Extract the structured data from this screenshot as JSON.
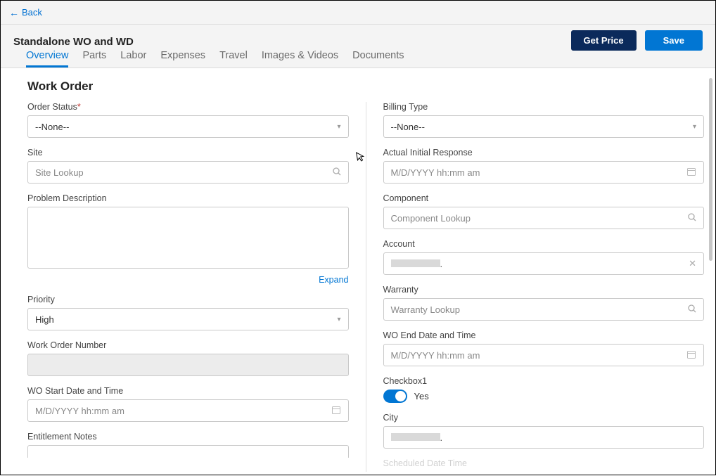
{
  "nav": {
    "back": "Back"
  },
  "header": {
    "title": "Standalone WO and WD",
    "getPrice": "Get Price",
    "save": "Save",
    "tabs": [
      "Overview",
      "Parts",
      "Labor",
      "Expenses",
      "Travel",
      "Images & Videos",
      "Documents"
    ]
  },
  "section": {
    "title": "Work Order"
  },
  "left": {
    "orderStatus": {
      "label": "Order Status",
      "value": "--None--"
    },
    "site": {
      "label": "Site",
      "placeholder": "Site Lookup"
    },
    "problemDesc": {
      "label": "Problem Description",
      "expand": "Expand"
    },
    "priority": {
      "label": "Priority",
      "value": "High"
    },
    "woNumber": {
      "label": "Work Order Number"
    },
    "woStart": {
      "label": "WO Start Date and Time",
      "placeholder": "M/D/YYYY  hh:mm am"
    },
    "entitlement": {
      "label": "Entitlement Notes"
    }
  },
  "right": {
    "billingType": {
      "label": "Billing Type",
      "value": "--None--"
    },
    "actualInitial": {
      "label": "Actual Initial Response",
      "placeholder": "M/D/YYYY  hh:mm am"
    },
    "component": {
      "label": "Component",
      "placeholder": "Component Lookup"
    },
    "account": {
      "label": "Account"
    },
    "warranty": {
      "label": "Warranty",
      "placeholder": "Warranty Lookup"
    },
    "woEnd": {
      "label": "WO End Date and Time",
      "placeholder": "M/D/YYYY  hh:mm am"
    },
    "checkbox1": {
      "label": "Checkbox1",
      "value": "Yes"
    },
    "city": {
      "label": "City"
    },
    "scheduled": {
      "label": "Scheduled Date Time"
    }
  }
}
